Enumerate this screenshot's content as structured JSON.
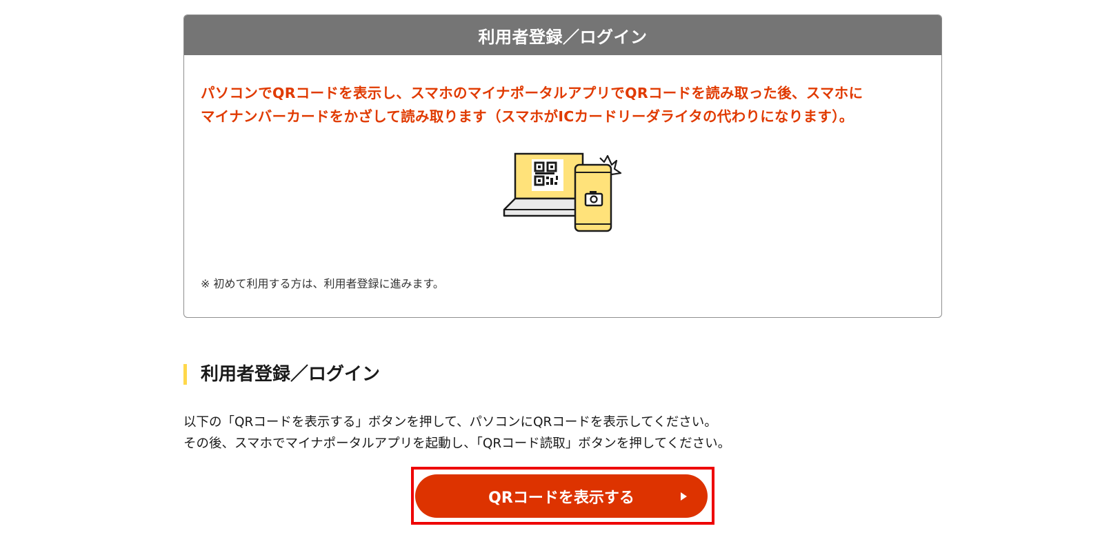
{
  "card": {
    "title": "利用者登録／ログイン",
    "lead_line1": "パソコンでQRコードを表示し、スマホのマイナポータルアプリでQRコードを読み取った後、スマホに",
    "lead_line2": "マイナンバーカードをかざして読み取ります（スマホがICカードリーダライタの代わりになります）。",
    "note": "※ 初めて利用する方は、利用者登録に進みます。"
  },
  "section": {
    "title": "利用者登録／ログイン",
    "desc_line1": "以下の「QRコードを表示する」ボタンを押して、パソコンにQRコードを表示してください。",
    "desc_line2": "その後、スマホでマイナポータルアプリを起動し、「QRコード読取」ボタンを押してください。"
  },
  "button": {
    "label": "QRコードを表示する",
    "icon": "play-arrow-icon"
  },
  "colors": {
    "header_bg": "#757575",
    "accent_red": "#e03a00",
    "button_bg": "#dd3300",
    "section_bar": "#ffd84a",
    "illustration_yellow": "#ffe27a",
    "highlight_box": "#ee0000"
  }
}
